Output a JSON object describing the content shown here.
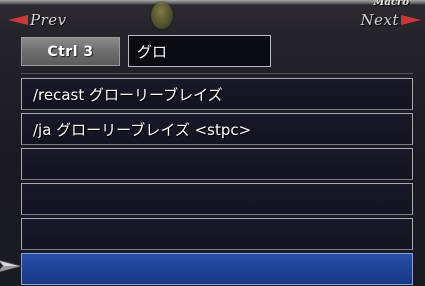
{
  "navigation": {
    "prev_label": "Prev",
    "next_label": "Next",
    "macro_label": "Macro"
  },
  "macro": {
    "key": "Ctrl 3",
    "name": "グロ",
    "lines": [
      "/recast グローリーブレイズ",
      "/ja グローリーブレイズ <stpc>",
      "",
      "",
      "",
      ""
    ],
    "selected_line_index": 5
  },
  "colors": {
    "arrow": "#c93838",
    "selected_line": "#2a4fa8",
    "line_border": "#a9a9b2",
    "key_badge": "#7a7a7a"
  }
}
